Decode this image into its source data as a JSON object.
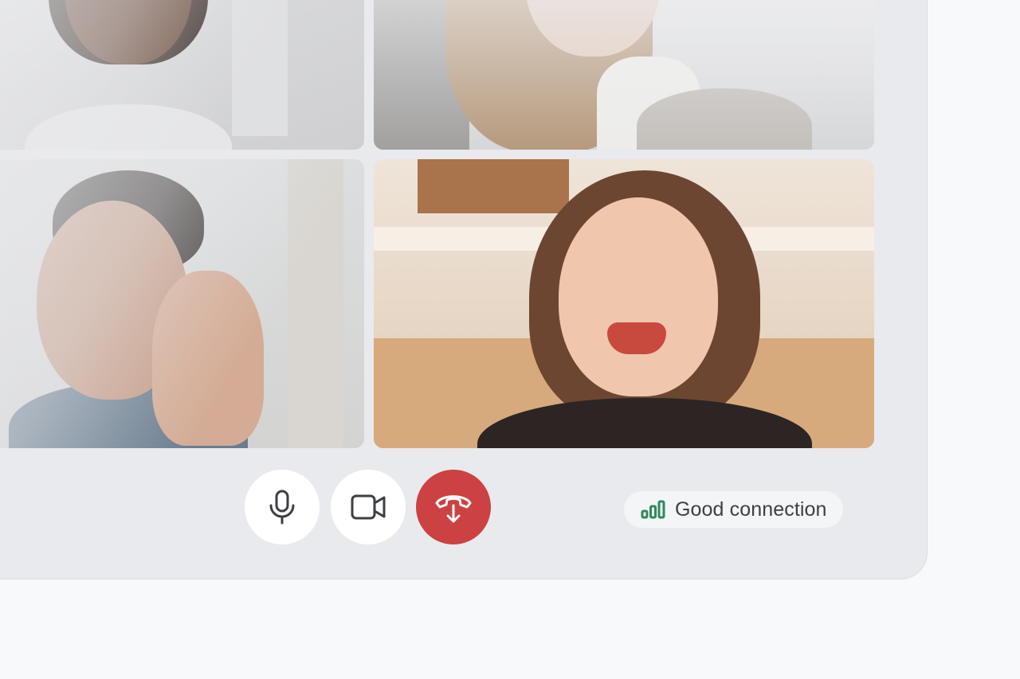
{
  "call": {
    "participants": [
      {
        "id": "participant-1"
      },
      {
        "id": "participant-2"
      },
      {
        "id": "participant-3"
      },
      {
        "id": "participant-4",
        "active": true
      }
    ],
    "controls": {
      "mic_icon": "microphone-icon",
      "camera_icon": "video-camera-icon",
      "end_icon": "hang-up-icon"
    },
    "status": {
      "label": "Good connection",
      "icon": "signal-bars-icon",
      "signal_bars_filled": 3,
      "signal_bars_total": 3
    }
  },
  "colors": {
    "end_call": "#cc4141",
    "signal": "#2e8a5f",
    "panel": "#e9eaed",
    "page": "#f8f9fa",
    "icon_dark": "#3b3f46"
  }
}
